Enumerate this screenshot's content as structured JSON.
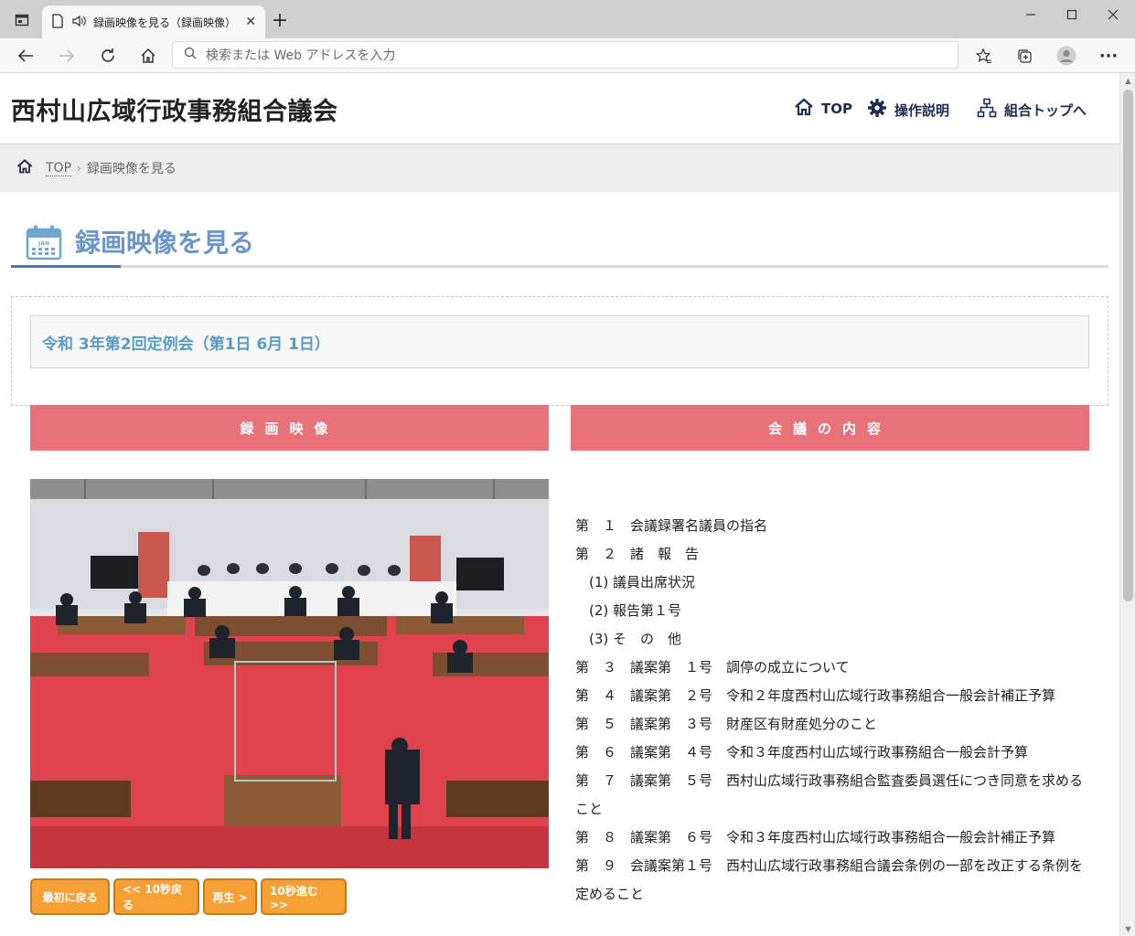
{
  "browser": {
    "tab_title": "録画映像を見る（録画映像）",
    "address_placeholder": "検索または Web アドレスを入力"
  },
  "site": {
    "title": "西村山広域行政事務組合議会",
    "nav": [
      {
        "label": "TOP"
      },
      {
        "label": "操作説明"
      },
      {
        "label": "組合トップへ"
      }
    ]
  },
  "breadcrumb": {
    "top": "TOP",
    "current": "録画映像を見る"
  },
  "page": {
    "heading": "録画映像を見る",
    "calendar_label": "JAN",
    "meeting_title": "令和 3年第2回定例会（第1日 6月 1日）"
  },
  "sections": {
    "video": "録画映像",
    "content": "会議の内容"
  },
  "controls": {
    "restart": "最初に戻る",
    "back10": "<< 10秒戻る",
    "play": "再生 >",
    "fwd10": "10秒進む >>"
  },
  "agenda": [
    "第　１　会議録署名議員の指名",
    "第　２　諸　報　告",
    "　(1) 議員出席状況",
    "　(2) 報告第１号",
    "　(3) そ　の　他",
    "第　３　議案第　１号　調停の成立について",
    "第　４　議案第　２号　令和２年度西村山広域行政事務組合一般会計補正予算",
    "第　５　議案第　３号　財産区有財産処分のこと",
    "第　６　議案第　４号　令和３年度西村山広域行政事務組合一般会計予算",
    "第　７　議案第　５号　西村山広域行政事務組合監査委員選任につき同意を求めること",
    "第　８　議案第　６号　令和３年度西村山広域行政事務組合一般会計補正予算",
    "第　９　会議案第１号　西村山広域行政事務組合議会条例の一部を改正する条例を定めること"
  ]
}
